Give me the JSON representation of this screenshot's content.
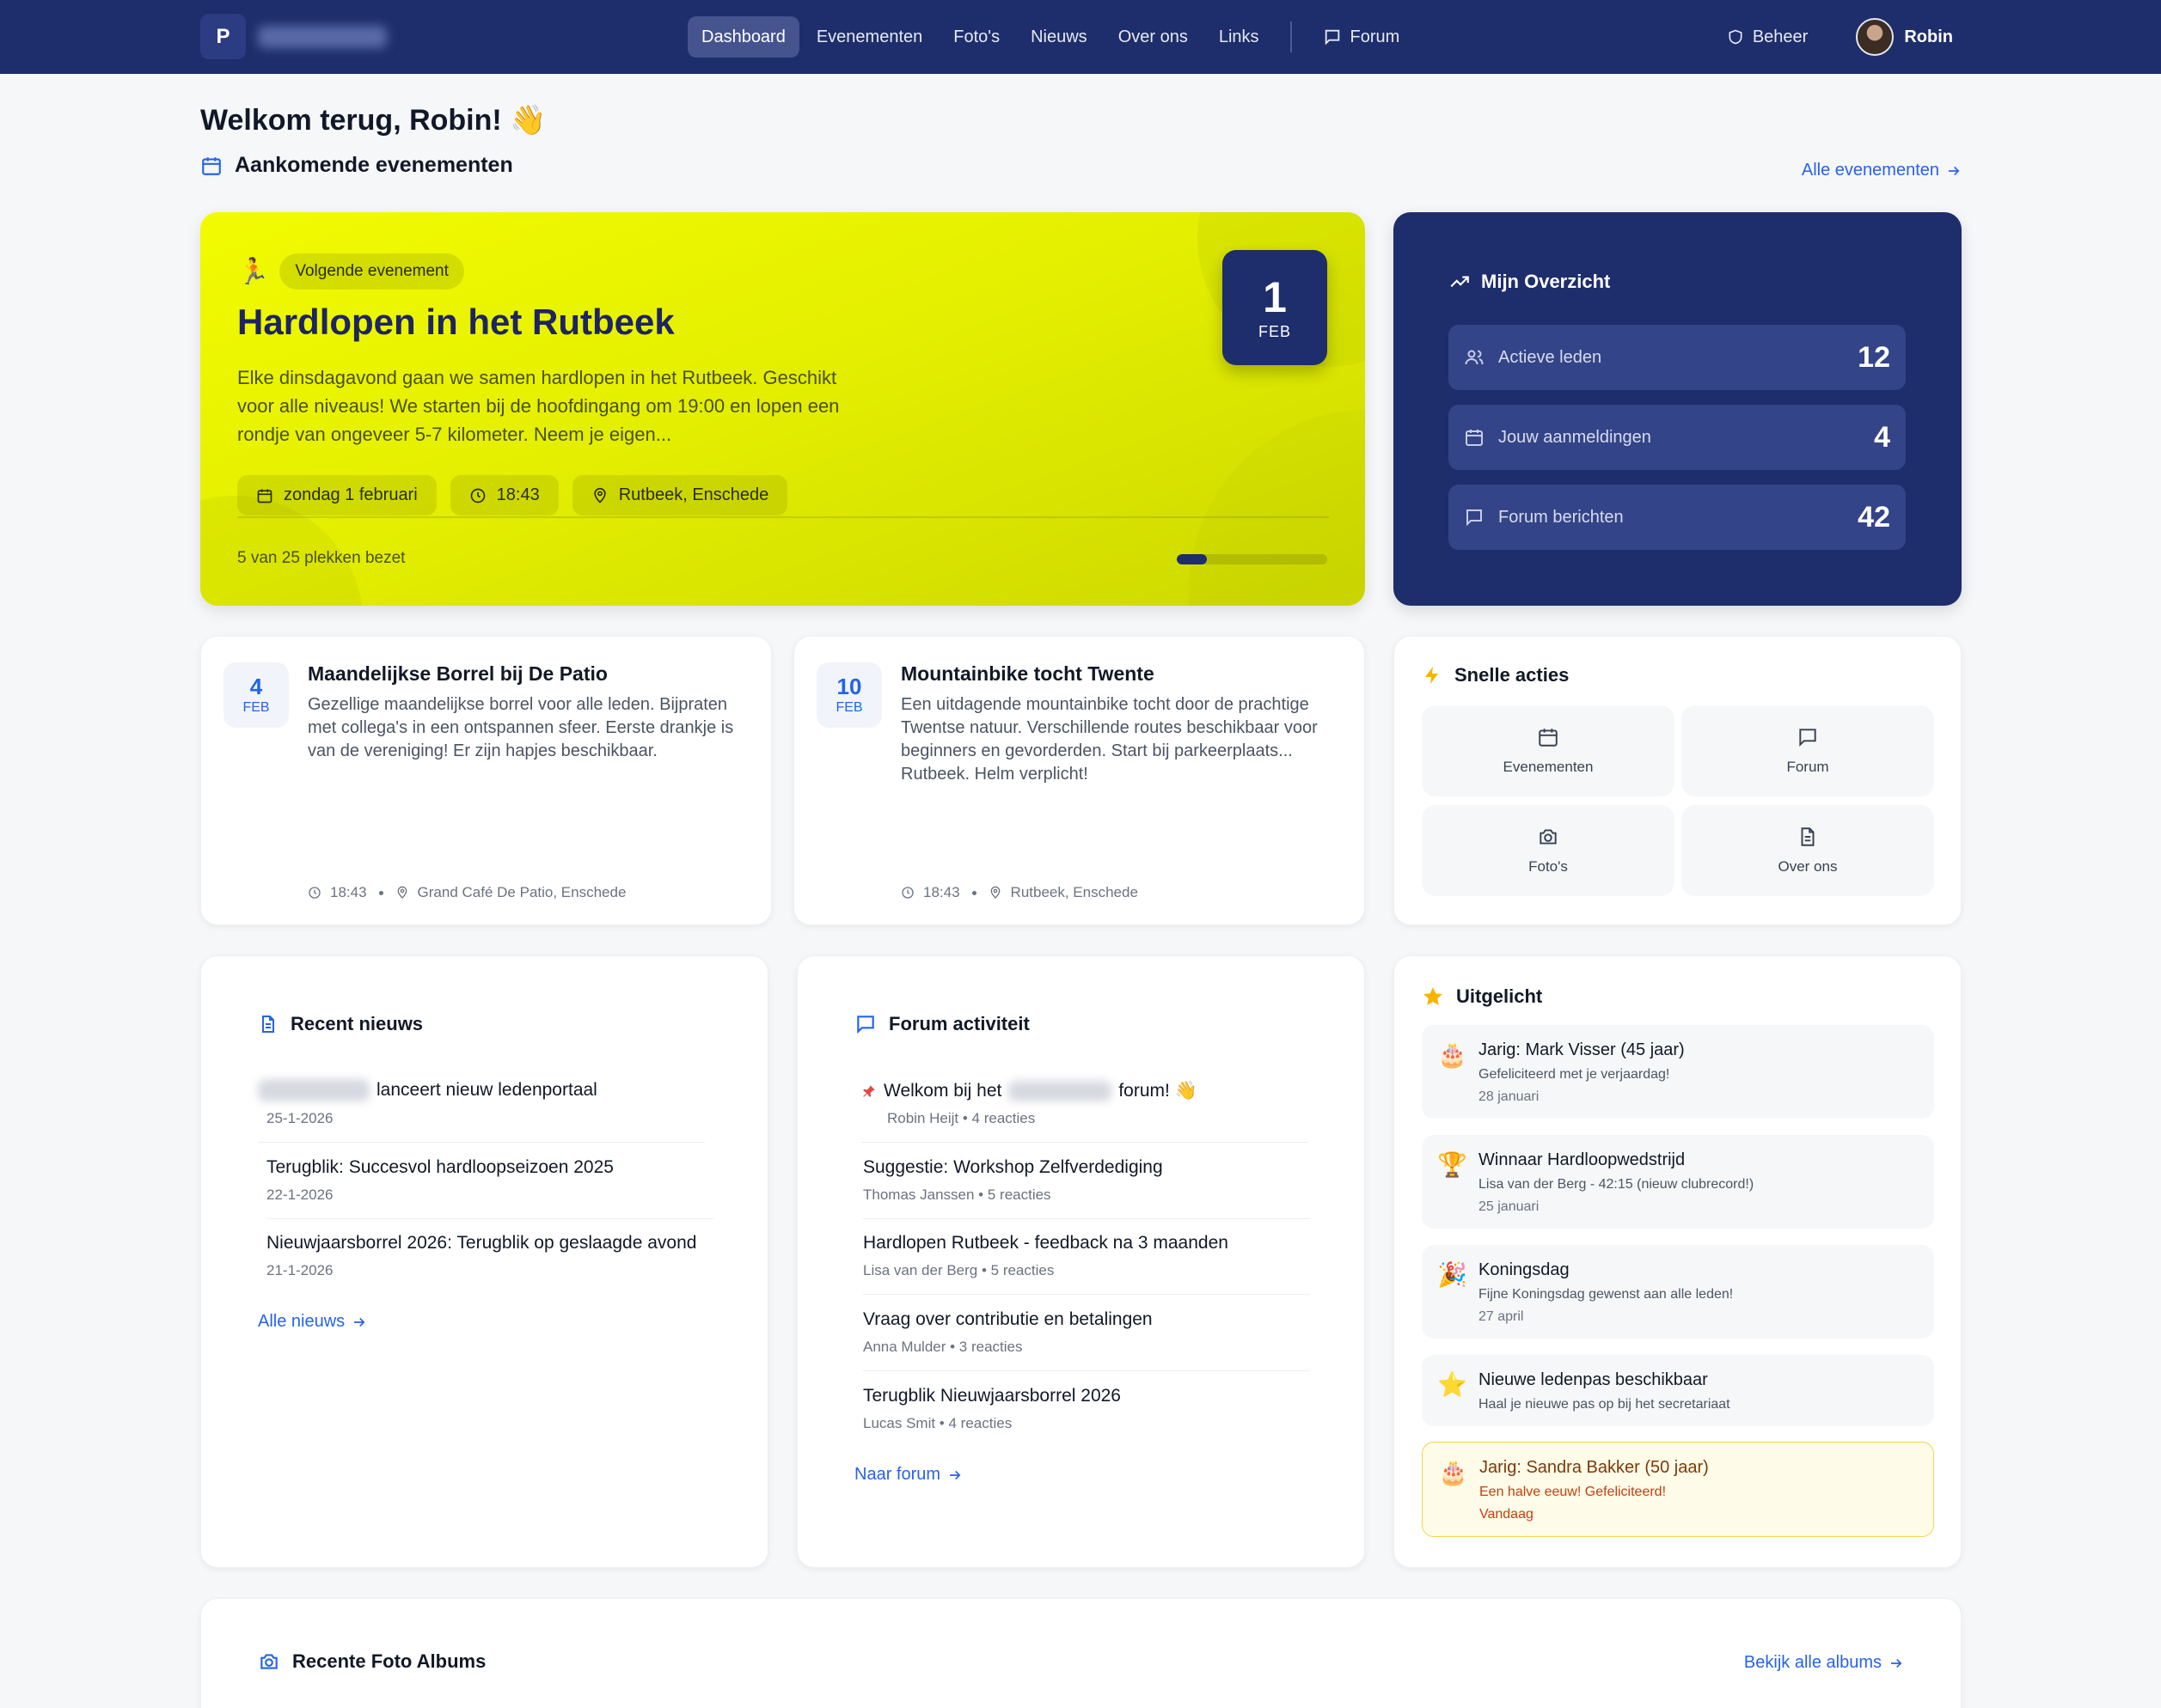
{
  "nav": {
    "logo_letter": "P",
    "links": [
      "Dashboard",
      "Evenementen",
      "Foto's",
      "Nieuws",
      "Over ons",
      "Links"
    ],
    "forum": "Forum",
    "admin": "Beheer",
    "user_name": "Robin"
  },
  "welcome": "Welkom terug, Robin! 👋",
  "upcoming": {
    "heading": "Aankomende evenementen",
    "all_link": "Alle evenementen"
  },
  "hero": {
    "icon": "🏃",
    "badge": "Volgende evenement",
    "title": "Hardlopen in het Rutbeek",
    "description": "Elke dinsdagavond gaan we samen hardlopen in het Rutbeek. Geschikt voor alle niveaus! We starten bij de hoofdingang om 19:00 en lopen een rondje van ongeveer 5-7 kilometer. Neem je eigen...",
    "day": "1",
    "month": "FEB",
    "date": "zondag 1 februari",
    "time": "18:43",
    "location": "Rutbeek, Enschede",
    "spots": "5 van 25 plekken bezet",
    "spots_taken": 5,
    "spots_total": 25
  },
  "overview": {
    "title": "Mijn Overzicht",
    "stats": [
      {
        "label": "Actieve leden",
        "value": "12",
        "icon": "users-icon"
      },
      {
        "label": "Jouw aanmeldingen",
        "value": "4",
        "icon": "calendar-icon"
      },
      {
        "label": "Forum berichten",
        "value": "42",
        "icon": "chat-icon"
      }
    ]
  },
  "events": [
    {
      "day": "4",
      "month": "FEB",
      "title": "Maandelijkse Borrel bij De Patio",
      "description": "Gezellige maandelijkse borrel voor alle leden. Bijpraten met collega's in een ontspannen sfeer. Eerste drankje is van de vereniging! Er zijn hapjes beschikbaar.",
      "time": "18:43",
      "location": "Grand Café De Patio, Enschede"
    },
    {
      "day": "10",
      "month": "FEB",
      "title": "Mountainbike tocht Twente",
      "description": "Een uitdagende mountainbike tocht door de prachtige Twentse natuur. Verschillende routes beschikbaar voor beginners en gevorderden. Start bij parkeerplaats... Rutbeek. Helm verplicht!",
      "time": "18:43",
      "location": "Rutbeek, Enschede"
    }
  ],
  "quick": {
    "title": "Snelle acties",
    "actions": [
      "Evenementen",
      "Forum",
      "Foto's",
      "Over ons"
    ]
  },
  "news": {
    "title": "Recent nieuws",
    "items": [
      {
        "title": "lanceert nieuw ledenportaal",
        "date": "25-1-2026"
      },
      {
        "title": "Terugblik: Succesvol hardloopseizoen 2025",
        "date": "22-1-2026"
      },
      {
        "title": "Nieuwjaarsborrel 2026: Terugblik op geslaagde avond",
        "date": "21-1-2026"
      }
    ],
    "all_link": "Alle nieuws"
  },
  "forum": {
    "title": "Forum activiteit",
    "pinned_prefix": "Welkom bij het",
    "pinned_suffix": "forum! 👋",
    "pinned_meta": "Robin Heijt • 4 reacties",
    "items": [
      {
        "title": "Suggestie: Workshop Zelfverdediging",
        "meta": "Thomas Janssen • 5 reacties"
      },
      {
        "title": "Hardlopen Rutbeek - feedback na 3 maanden",
        "meta": "Lisa van der Berg • 5 reacties"
      },
      {
        "title": "Vraag over contributie en betalingen",
        "meta": "Anna Mulder • 3 reacties"
      },
      {
        "title": "Terugblik Nieuwjaarsborrel 2026",
        "meta": "Lucas Smit • 4 reacties"
      }
    ],
    "all_link": "Naar forum"
  },
  "featured": {
    "title": "Uitgelicht",
    "items": [
      {
        "icon": "🎂",
        "title": "Jarig: Mark Visser (45 jaar)",
        "sub": "Gefeliciteerd met je verjaardag!",
        "date": "28 januari"
      },
      {
        "icon": "🏆",
        "title": "Winnaar Hardloopwedstrijd",
        "sub": "Lisa van der Berg - 42:15 (nieuw clubrecord!)",
        "date": "25 januari"
      },
      {
        "icon": "🎉",
        "title": "Koningsdag",
        "sub": "Fijne Koningsdag gewenst aan alle leden!",
        "date": "27 april"
      },
      {
        "icon": "⭐",
        "title": "Nieuwe ledenpas beschikbaar",
        "sub": "Haal je nieuwe pas op bij het secretariaat",
        "date": ""
      },
      {
        "icon": "🎂",
        "title": "Jarig: Sandra Bakker (50 jaar)",
        "sub": "Een halve eeuw! Gefeliciteerd!",
        "date": "Vandaag"
      }
    ]
  },
  "albums": {
    "title": "Recente Foto Albums",
    "all_link": "Bekijk alle albums"
  },
  "colors": {
    "navy": "#1e2d6b",
    "accent_yellow": "#eef800",
    "link_blue": "#2563eb"
  }
}
